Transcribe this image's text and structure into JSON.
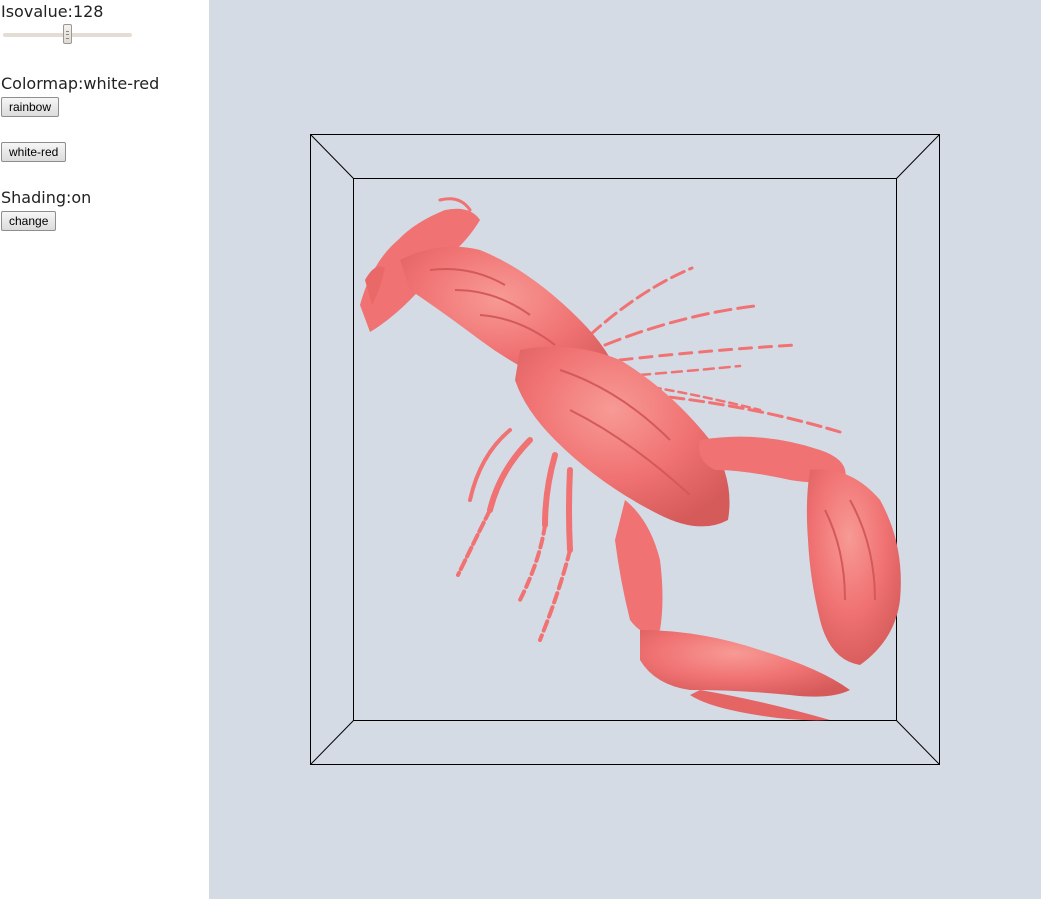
{
  "controls": {
    "isovalue_label": "Isovalue:128",
    "isovalue": {
      "value": 128,
      "min": 0,
      "max": 255
    },
    "colormap_label": "Colormap:white-red",
    "rainbow_button": "rainbow",
    "white_red_button": "white-red",
    "shading_label": "Shading:on",
    "change_button": "change"
  },
  "viewport": {
    "background": "#d4dbe5",
    "isosurface_color": "#f07272",
    "isosurface_shadow": "#c85050",
    "bounding_box_color": "#000000",
    "subject": "lobster isosurface"
  }
}
